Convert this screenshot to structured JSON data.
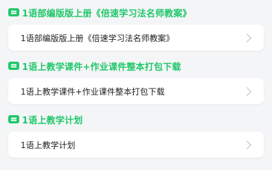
{
  "sections": [
    {
      "header": "1语部编版版上册《倍速学习法名师教案》",
      "item": "1语部编版版上册《倍速学习法名师教案》"
    },
    {
      "header": "1语上教学课件+作业课件整本打包下载",
      "item": "1语上教学课件+作业课件整本打包下载"
    },
    {
      "header": "1语上教学计划",
      "item": "1语上教学计划"
    }
  ],
  "colors": {
    "accent": "#1fc76a",
    "background": "#f4f5f7",
    "card": "#ffffff",
    "text": "#222222",
    "chevron": "#b8bdc6"
  },
  "icons": {
    "section": "list-icon",
    "item": "chevron-right-icon"
  }
}
